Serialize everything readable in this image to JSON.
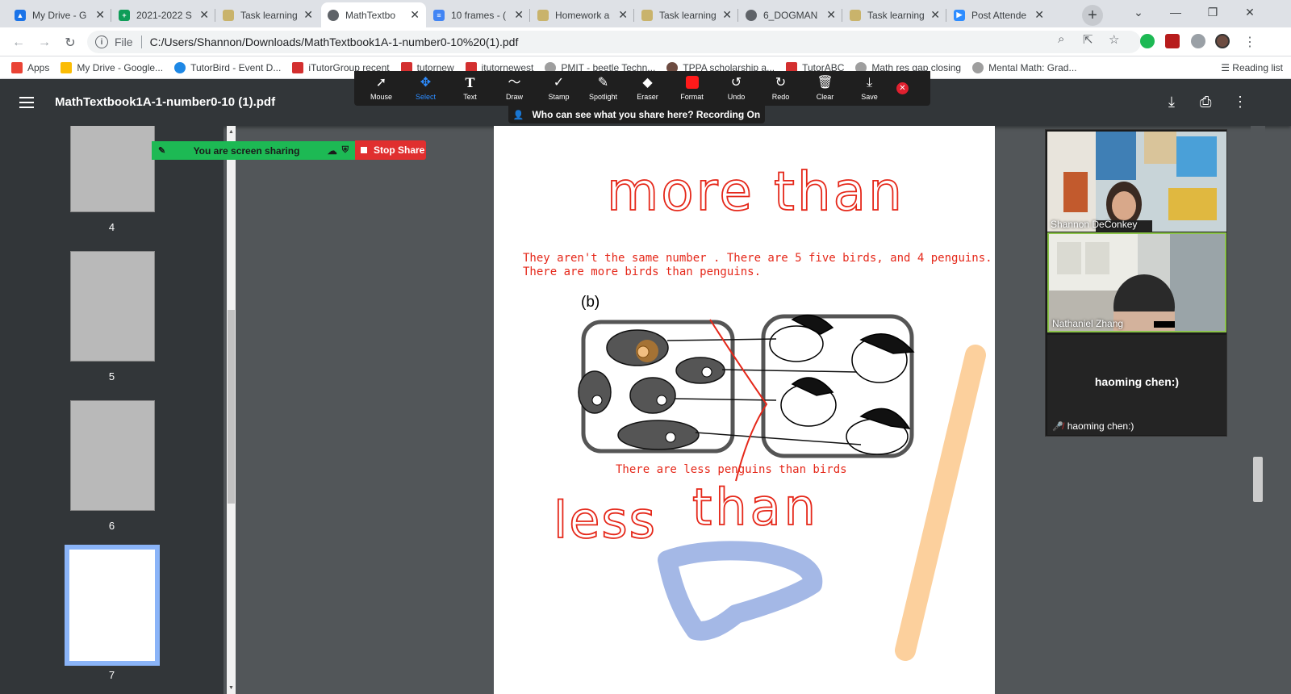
{
  "browser": {
    "tabs": [
      {
        "title": "My Drive - G",
        "color": "#1a73e8"
      },
      {
        "title": "2021-2022 S",
        "color": "#0f9d58"
      },
      {
        "title": "Task learning",
        "color": "#c9b36b"
      },
      {
        "title": "MathTextbo",
        "color": "#5f6368"
      },
      {
        "title": "10 frames - (",
        "color": "#4285f4"
      },
      {
        "title": "Homework a",
        "color": "#c9b36b"
      },
      {
        "title": "Task learning",
        "color": "#c9b36b"
      },
      {
        "title": "6_DOGMAN",
        "color": "#5f6368"
      },
      {
        "title": "Task learning",
        "color": "#c9b36b"
      },
      {
        "title": "Post Attende",
        "color": "#2d8cff"
      }
    ],
    "active_tab_index": 3,
    "address": {
      "scheme_label": "File",
      "url": "C:/Users/Shannon/Downloads/MathTextbook1A-1-number0-10%20(1).pdf"
    },
    "bookmarks": [
      {
        "label": "Apps",
        "color": "#ea4335"
      },
      {
        "label": "My Drive - Google...",
        "color": "#fbbc04"
      },
      {
        "label": "TutorBird - Event D...",
        "color": "#1e88e5"
      },
      {
        "label": "iTutorGroup recent",
        "color": "#d32f2f"
      },
      {
        "label": "tutornew",
        "color": "#d32f2f"
      },
      {
        "label": "itutornewest",
        "color": "#d32f2f"
      },
      {
        "label": "PMIT - beetle Techn...",
        "color": "#9e9e9e"
      },
      {
        "label": "TPPA scholarship a...",
        "color": "#6d4c41"
      },
      {
        "label": "TutorABC",
        "color": "#d32f2f"
      },
      {
        "label": "Math res gap closing",
        "color": "#9e9e9e"
      },
      {
        "label": "Mental Math: Grad...",
        "color": "#9e9e9e"
      }
    ],
    "reading_list": "Reading list"
  },
  "pdf": {
    "title": "MathTextbook1A-1-number0-10 (1).pdf",
    "thumbnails": [
      {
        "page": "4"
      },
      {
        "page": "5"
      },
      {
        "page": "6"
      },
      {
        "page": "7"
      }
    ]
  },
  "zoom_toolbar": {
    "tools": [
      {
        "label": "Mouse",
        "icon": "cursor-icon",
        "glyph": "➚"
      },
      {
        "label": "Select",
        "icon": "move-icon",
        "glyph": "✥"
      },
      {
        "label": "Text",
        "icon": "text-icon",
        "glyph": "T"
      },
      {
        "label": "Draw",
        "icon": "draw-icon",
        "glyph": "〜"
      },
      {
        "label": "Stamp",
        "icon": "stamp-icon",
        "glyph": "✓"
      },
      {
        "label": "Spotlight",
        "icon": "spotlight-icon",
        "glyph": "✎"
      },
      {
        "label": "Eraser",
        "icon": "eraser-icon",
        "glyph": "◆"
      },
      {
        "label": "Format",
        "icon": "format-icon",
        "glyph": ""
      },
      {
        "label": "Undo",
        "icon": "undo-icon",
        "glyph": "↺"
      },
      {
        "label": "Redo",
        "icon": "redo-icon",
        "glyph": "↻"
      },
      {
        "label": "Clear",
        "icon": "trash-icon",
        "glyph": "🗑"
      },
      {
        "label": "Save",
        "icon": "save-icon",
        "glyph": "⤓"
      }
    ],
    "selected_tool": "Select",
    "notice": "Who can see what you share here? Recording On",
    "sharing_label": "You are screen sharing",
    "stop_share_label": "Stop Share"
  },
  "document": {
    "handwritten_top": "more than",
    "typed_line_1": "They aren't the same number .  There are 5 five birds, and 4 penguins.",
    "typed_line_2": "There are more birds than penguins.",
    "part_label": "(b)",
    "typed_line_3": "There are less penguins than birds",
    "handwritten_bottom_1": "less",
    "handwritten_bottom_2": "than",
    "ink_red": "#e5281a",
    "ink_blue": "#a4b8e6",
    "ink_orange": "#fcd09d"
  },
  "zoom_gallery": {
    "participants": [
      {
        "name": "Shannon DeConkey",
        "video": true
      },
      {
        "name": "Nathaniel Zhang",
        "video": true
      },
      {
        "name": "haoming chen:)",
        "video": false
      }
    ]
  }
}
